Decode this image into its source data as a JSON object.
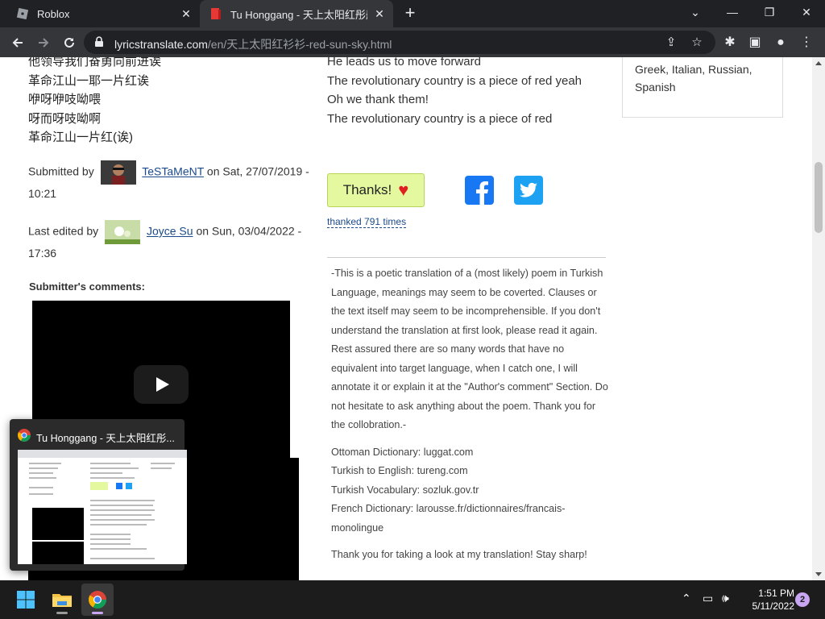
{
  "browser": {
    "tabs": [
      {
        "title": "Roblox",
        "close": "✕"
      },
      {
        "title": "Tu Honggang - 天上太阳红彤彤",
        "close": "✕"
      }
    ],
    "new_tab": "+",
    "window_controls": {
      "dropdown": "⌄",
      "minimize": "—",
      "restore": "❐",
      "close": "✕"
    },
    "url_host": "lyricstranslate.com",
    "url_path": "/en/天上太阳红衫衫-red-sun-sky.html"
  },
  "lyrics": {
    "original_lines": [
      "他领导我们奋勇向前进诶",
      "革命江山一耶一片红诶",
      "咿呀咿吱呦喂",
      "呀而呀吱呦啊",
      "革命江山一片红(诶)"
    ],
    "translation_lines": [
      "He leads us to move forward",
      "The revolutionary country is a piece of red yeah",
      "Oh we thank them!",
      "The revolutionary country is a piece of red"
    ]
  },
  "meta": {
    "submitted_by_label": "Submitted by",
    "submitter": "TeSTaMeNT",
    "submitted_on": "on Sat, 27/07/2019 - 10:21",
    "edited_by_label": "Last edited by",
    "editor": "Joyce Su",
    "edited_on": "on Sun, 03/04/2022 - 17:36",
    "comments_heading": "Submitter's comments:"
  },
  "sidebar": {
    "languages_text": "Greek, Italian, Russian, Spanish"
  },
  "thanks": {
    "button_label": "Thanks!",
    "heart": "♥",
    "thanked_text": "thanked 791 times"
  },
  "comment": {
    "paragraph1": "-This is a poetic translation of a (most likely) poem in Turkish Language, meanings may seem to be coverted. Clauses or the text itself may seem to be incomprehensible. If you don't understand the translation at first look, please read it again. Rest assured there are so many words that have no equivalent into target language, when I catch one, I will annotate it or explain it at the \"Author's comment\" Section. Do not hesitate to ask anything about the poem. Thank you for the collobration.-",
    "resources": [
      "Ottoman Dictionary: luggat.com",
      "Turkish to English: tureng.com",
      "Turkish Vocabulary: sozluk.gov.tr",
      "French Dictionary: larousse.fr/dictionnaires/francais-monolingue"
    ],
    "closing": "Thank you for taking a look at my translation! Stay sharp!"
  },
  "preview": {
    "title": "Tu Honggang - 天上太阳红彤..."
  },
  "taskbar": {
    "time": "1:51 PM",
    "date": "5/11/2022",
    "notifications": "2"
  },
  "colors": {
    "chrome_dark": "#202124",
    "chrome_toolbar": "#35363a",
    "thanks_bg": "#e4f8a0",
    "facebook": "#1877f2",
    "twitter": "#1da1f2",
    "link": "#1a4a8a"
  }
}
